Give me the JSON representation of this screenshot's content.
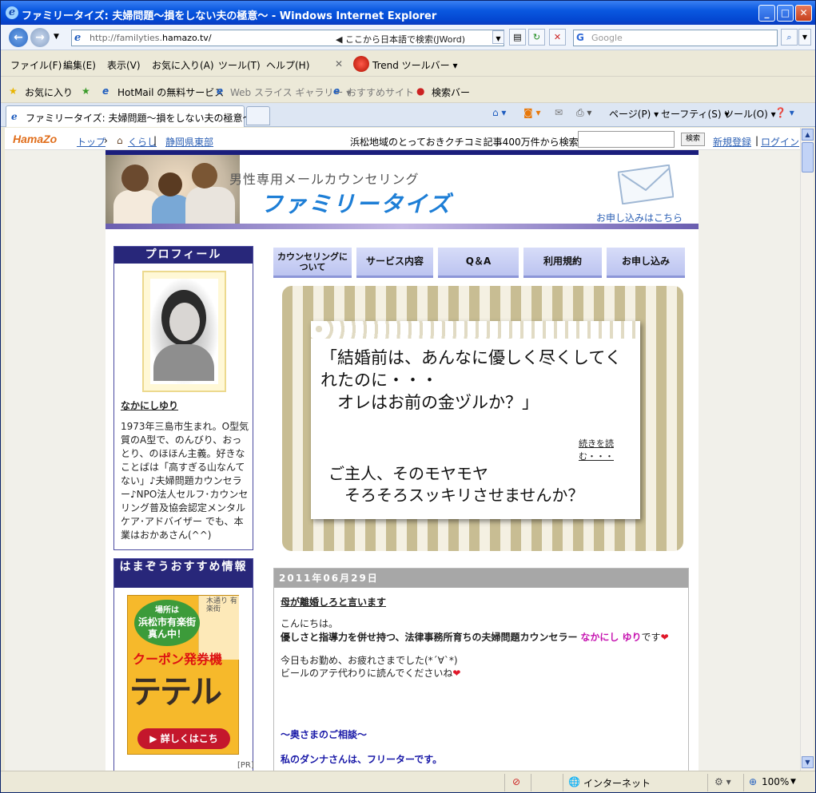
{
  "window": {
    "title": "ファミリータイズ: 夫婦問題～損をしない夫の極意～ - Windows Internet Explorer",
    "url_prefix": "http://familyties.",
    "url_domain": "hamazo.tv/",
    "addr_search": "◀ ここから日本語で検索(JWord)",
    "search_placeholder": "Google"
  },
  "menu": [
    "ファイル(F)",
    "編集(E)",
    "表示(V)",
    "お気に入り(A)",
    "ツール(T)",
    "ヘルプ(H)"
  ],
  "trend_toolbar": "Trend ツールバー ▾",
  "favorites": {
    "fav": "お気に入り",
    "hotmail": "HotMail の無料サービス",
    "slice": "Web スライス ギャラリー ▾",
    "recommend": "おすすめサイト ▾",
    "searchbar": "検索バー"
  },
  "tab": {
    "label": "ファミリータイズ: 夫婦問題～損をしない夫の極意～",
    "page": "ページ(P) ▾",
    "safety": "セーフティ(S) ▾",
    "tools": "ツール(O) ▾"
  },
  "hamazo": {
    "logo": "HamaZo",
    "top": "トップ",
    "kurashi": "くらし",
    "region": "静岡県東部",
    "promo": "浜松地域のとっておきクチコミ記事400万件から検索⇒",
    "search_btn": "検索",
    "register": "新規登録",
    "login": "ログイン"
  },
  "header": {
    "subtitle": "男性専用メールカウンセリング",
    "title": "ファミリータイズ",
    "apply": "お申し込みはこちら"
  },
  "profile": {
    "heading": "プロフィール",
    "name": "なかにしゆり",
    "bio": "1973年三島市生まれ。O型気質のA型で、のんびり、おっとり、のほほん主義。好きなことばは「高すぎる山なんてない」♪夫婦問題カウンセラー♪NPO法人セルフ･カウンセリング普及協会認定メンタルケア･アドバイザー でも、本業はおかあさん(^^)"
  },
  "recommend": {
    "heading": "はまぞうおすすめ情報",
    "bubble1": "場所は",
    "bubble2": "浜松市有楽街",
    "bubble3": "真ん中！",
    "map": "木通り 有楽街",
    "coupon": "クーポン発券機",
    "teteru": "テテル",
    "detail": "▶ 詳しくはこち",
    "pr": "[PR]"
  },
  "nav": [
    "カウンセリングについて",
    "サービス内容",
    "Q＆A",
    "利用規約",
    "お申し込み"
  ],
  "hero": {
    "quote": "「結婚前は、あんなに優しく尽くしてくれたのに・・・\n　オレはお前の金ヅルか？」",
    "more": "続きを読む・・・",
    "question": "ご主人、そのモヤモヤ\n　そろそろスッキリさせませんか？"
  },
  "post": {
    "date": "2011年06月29日",
    "title": "母が離婚しろと言います",
    "hello": "こんにちは。",
    "intro": "優しさと指導力を併せ持つ、法律事務所育ちの夫婦問題カウンセラー",
    "author": "なかにし ゆり",
    "desu": "です",
    "greet1": "今日もお勤め、お疲れさまでした(*´∀`*)",
    "greet2": "ビールのアテ代わりに読んでくださいね",
    "consult": "～奥さまのご相談～",
    "line1": "私のダンナさんは、フリーターです。"
  },
  "status": {
    "zone": "インターネット",
    "zoom": "100%"
  }
}
